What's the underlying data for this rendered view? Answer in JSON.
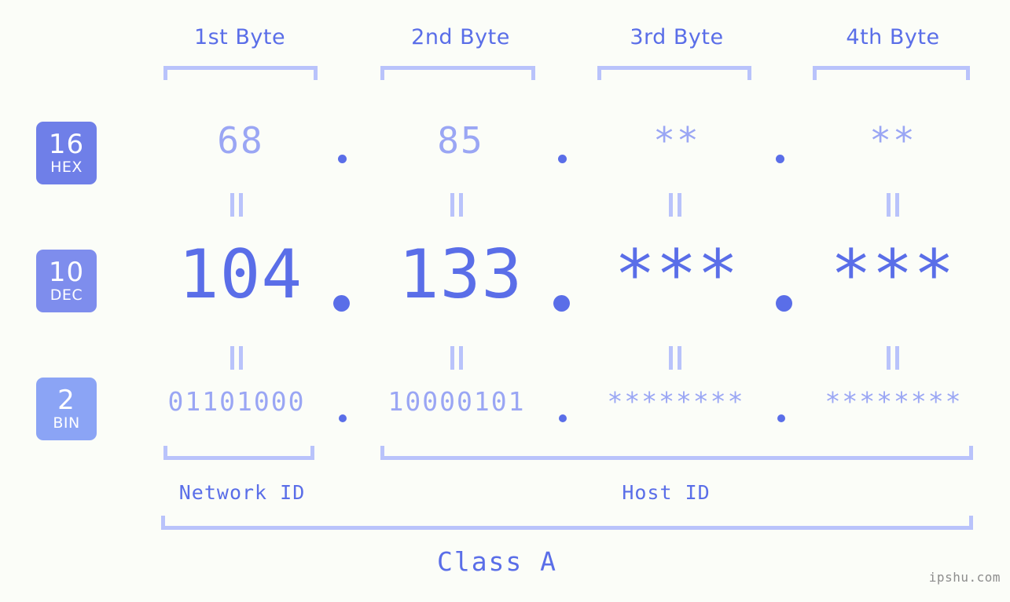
{
  "colors": {
    "background": "#fbfdf8",
    "accent_strong": "#5a6ee8",
    "accent_light": "#9aa6f4",
    "bracket": "#b9c3fb",
    "badge_hex": "#6f7fe8",
    "badge_dec": "#7e8ded",
    "badge_bin": "#8ba4f5",
    "watermark": "#8d8d8d"
  },
  "byte_headers": [
    {
      "label": "1st Byte"
    },
    {
      "label": "2nd Byte"
    },
    {
      "label": "3rd Byte"
    },
    {
      "label": "4th Byte"
    }
  ],
  "bases": [
    {
      "num": "16",
      "name": "HEX"
    },
    {
      "num": "10",
      "name": "DEC"
    },
    {
      "num": "2",
      "name": "BIN"
    }
  ],
  "rows": {
    "hex": {
      "values": [
        "68",
        "85",
        "**",
        "**"
      ]
    },
    "dec": {
      "values": [
        "104",
        "133",
        "***",
        "***"
      ]
    },
    "bin": {
      "values": [
        "01101000",
        "10000101",
        "********",
        "********"
      ]
    }
  },
  "separator": ".",
  "equality_mark": "||",
  "groups": {
    "network_id": "Network ID",
    "host_id": "Host ID",
    "class": "Class A"
  },
  "watermark": "ipshu.com"
}
